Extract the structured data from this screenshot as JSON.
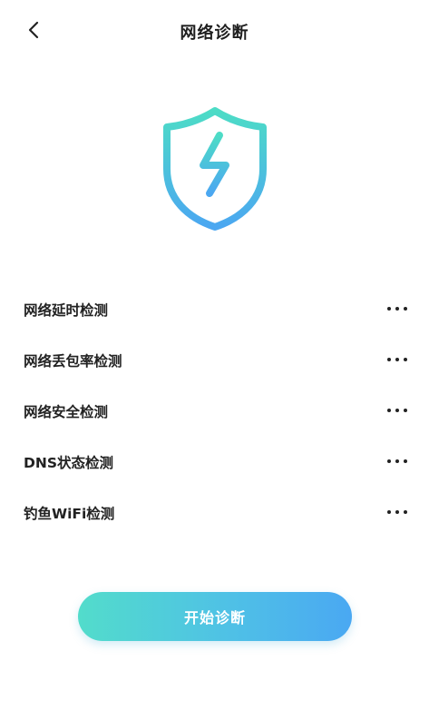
{
  "header": {
    "back_icon": "chevron-left-icon",
    "title": "网络诊断"
  },
  "hero": {
    "icon": "shield-lightning-icon",
    "gradient_top": "#4ddcc6",
    "gradient_bottom": "#4ba7f1"
  },
  "checks": [
    {
      "label": "网络延时检测",
      "status_icon": "more-icon"
    },
    {
      "label": "网络丢包率检测",
      "status_icon": "more-icon"
    },
    {
      "label": "网络安全检测",
      "status_icon": "more-icon"
    },
    {
      "label": "DNS状态检测",
      "status_icon": "more-icon"
    },
    {
      "label": "钓鱼WiFi检测",
      "status_icon": "more-icon"
    }
  ],
  "action": {
    "start_label": "开始诊断"
  }
}
